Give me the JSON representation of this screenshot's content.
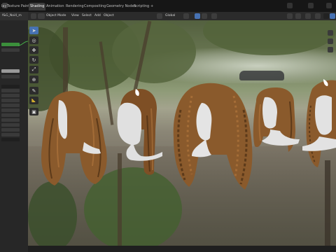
{
  "app": {
    "accent": "#4772b3",
    "node_accent": "#3b8f3b"
  },
  "workspace_tabs": [
    {
      "label": "lay",
      "active": false
    },
    {
      "label": "Texture Paint",
      "active": false
    },
    {
      "label": "Shading",
      "active": true
    },
    {
      "label": "Animation",
      "active": false
    },
    {
      "label": "Rendering",
      "active": false
    },
    {
      "label": "Compositing",
      "active": false
    },
    {
      "label": "Geometry Nodes",
      "active": false
    },
    {
      "label": "Scripting",
      "active": false
    },
    {
      "label": "+",
      "active": false
    }
  ],
  "left_panel": {
    "material_name": "f&G_Noi4_m"
  },
  "viewport_header": {
    "mode": "Object Mode",
    "menus": [
      "View",
      "Select",
      "Add",
      "Object"
    ],
    "orientation": "Global"
  },
  "tools": [
    {
      "icon": "select-cursor-icon",
      "glyph": "➤"
    },
    {
      "icon": "cursor-icon",
      "glyph": "◎"
    },
    {
      "icon": "move-icon",
      "glyph": "✥"
    },
    {
      "icon": "rotate-icon",
      "glyph": "↻"
    },
    {
      "icon": "scale-icon",
      "glyph": "⤢"
    },
    {
      "icon": "transform-icon",
      "glyph": "⊕"
    },
    {
      "icon": "annotate-icon",
      "glyph": "✎"
    },
    {
      "icon": "measure-icon",
      "glyph": "📐"
    },
    {
      "icon": "add-cube-icon",
      "glyph": "▣"
    }
  ]
}
